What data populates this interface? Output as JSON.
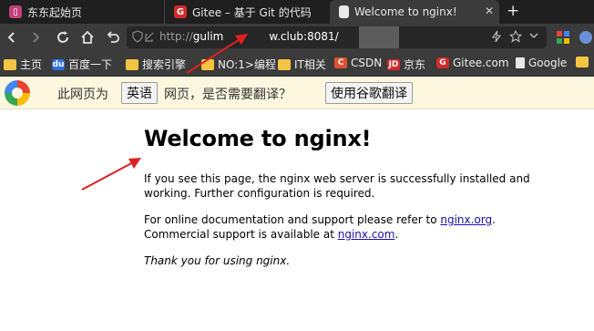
{
  "tabs": [
    {
      "title": "东东起始页",
      "icon": "page-favicon-pink"
    },
    {
      "title": "Gitee – 基于 Git 的代码",
      "icon": "gitee-favicon"
    },
    {
      "title": "Welcome to nginx!",
      "icon": "page-favicon",
      "active": true,
      "close": "✕"
    }
  ],
  "new_tab": "+",
  "address": {
    "scheme": "http://",
    "host_visible": "gulim",
    "host_tail": "w.club:8081/",
    "icons": [
      "back-icon",
      "forward-icon",
      "reload-icon",
      "home-icon",
      "undo-icon",
      "shield-icon",
      "lightning-icon",
      "star-icon",
      "chevron-down-icon",
      "apps-grid-icon"
    ]
  },
  "bookmarks": [
    {
      "label": "主页",
      "icon": "folder-icon"
    },
    {
      "label": "百度一下",
      "icon": "baidu-icon"
    },
    {
      "label": "搜索引擎",
      "icon": "folder-icon"
    },
    {
      "label": "NO:1>编程",
      "icon": "folder-icon"
    },
    {
      "label": "IT相关",
      "icon": "folder-icon"
    },
    {
      "label": "CSDN",
      "icon": "csdn-icon"
    },
    {
      "label": "京东",
      "icon": "jd-icon"
    },
    {
      "label": "Gitee.com",
      "icon": "gitee-icon"
    },
    {
      "label": "Google",
      "icon": "page-icon"
    }
  ],
  "translate_bar": {
    "prefix": "此网页为",
    "language_button": "英语",
    "middle": "网页，是否需要翻译？",
    "translate_button": "使用谷歌翻译"
  },
  "page": {
    "heading": "Welcome to nginx!",
    "para1": "If you see this page, the nginx web server is successfully installed and working. Further configuration is required.",
    "para2_before": "For online documentation and support please refer to ",
    "para2_link1": "nginx.org",
    "para2_mid": ".",
    "para2_line2": "Commercial support is available at ",
    "para2_link2": "nginx.com",
    "para2_end": ".",
    "thanks": "Thank you for using nginx."
  },
  "colors": {
    "annotation_red": "#e02020",
    "link": "#1a0dab",
    "translate_bg": "#fdf7df"
  }
}
